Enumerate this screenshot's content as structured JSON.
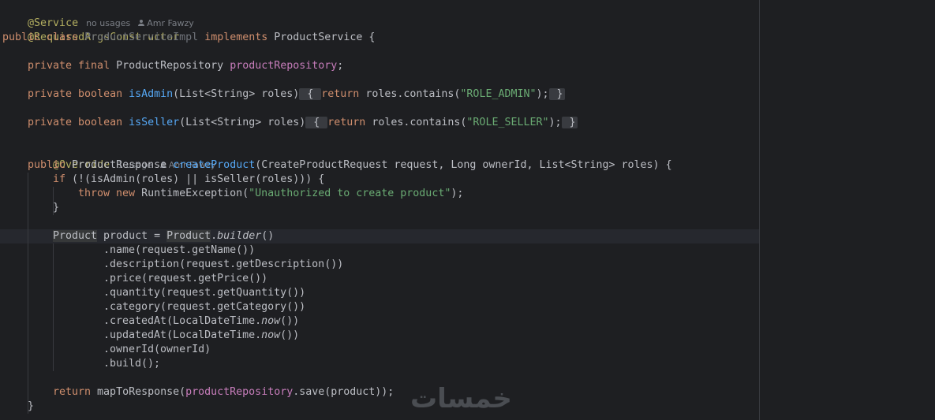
{
  "editor": {
    "lines": {
      "l1_ann": "@Service",
      "l1_usages": "no usages",
      "l1_author": "Amr Fawzy",
      "l2_ann": "@RequiredArgsConstructor",
      "l3_kw": "public class ",
      "l3_cls": "ProductServiceImpl",
      "l3_impl": " implements ",
      "l3_rest": "ProductService {",
      "l5_kw": "private final ",
      "l5_type": "ProductRepository ",
      "l5_field": "productRepository",
      "l5_end": ";",
      "l7_kw": "private boolean ",
      "l7_fn": "isAdmin",
      "l7_params": "(List<String> roles)",
      "l7_open": " { ",
      "l7_ret": "return ",
      "l7_body": "roles.contains(",
      "l7_str": "\"ROLE_ADMIN\"",
      "l7_end": ");",
      "l7_close": " }",
      "l9_kw": "private boolean ",
      "l9_fn": "isSeller",
      "l9_params": "(List<String> roles)",
      "l9_open": " { ",
      "l9_ret": "return ",
      "l9_body": "roles.contains(",
      "l9_str": "\"ROLE_SELLER\"",
      "l9_end": ");",
      "l9_close": " }",
      "l11_ann": "@Override",
      "l11_usages": "1 usage",
      "l11_author": "Amr Fawzy",
      "l12_kw": "public ",
      "l12_type": "ProductResponse ",
      "l12_fn": "createProduct",
      "l12_rest": "(CreateProductRequest request, Long ownerId, List<String> roles) {",
      "l13_kw": "if ",
      "l13_rest": "(!(isAdmin(roles) || isSeller(roles))) {",
      "l14_kw": "throw new ",
      "l14_rest": "RuntimeException(",
      "l14_str": "\"Unauthorized to create product\"",
      "l14_end": ");",
      "l15": "}",
      "l17_type": "Product",
      "l17_mid": " product = ",
      "l17_type2": "Product",
      "l17_dot": ".",
      "l17_fn": "builder",
      "l17_end": "()",
      "l18": ".name(request.getName())",
      "l19": ".description(request.getDescription())",
      "l20": ".price(request.getPrice())",
      "l21": ".quantity(request.getQuantity())",
      "l22": ".category(request.getCategory())",
      "l23_a": ".createdAt(LocalDateTime.",
      "l23_b": "now",
      "l23_c": "())",
      "l24_a": ".updatedAt(LocalDateTime.",
      "l24_b": "now",
      "l24_c": "())",
      "l25": ".ownerId(ownerId)",
      "l26": ".build();",
      "l28_kw": "return ",
      "l28_a": "mapToResponse(",
      "l28_field": "productRepository",
      "l28_b": ".save(product));",
      "l29": "}"
    }
  },
  "watermark": "خمسات",
  "colors": {
    "background": "#1e1f22",
    "keyword": "#cf8e6d",
    "annotation": "#b3ae60",
    "function": "#56a8f5",
    "field": "#c77dbb",
    "string": "#6aab73"
  }
}
